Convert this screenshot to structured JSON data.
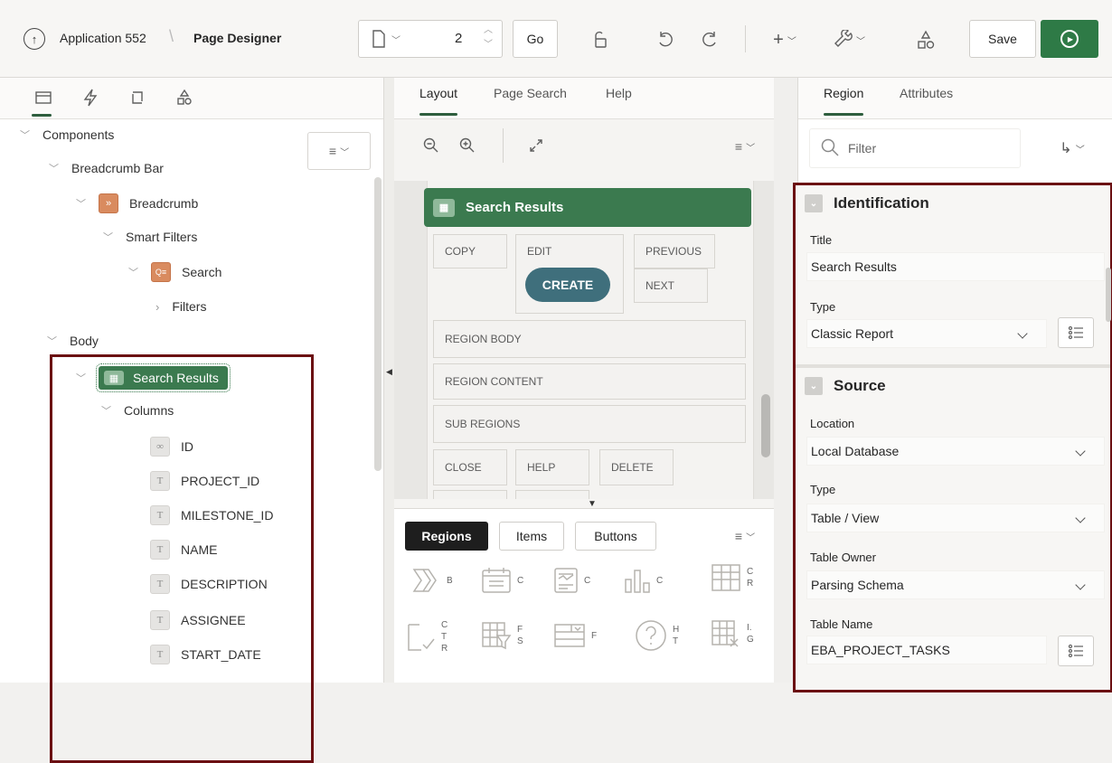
{
  "header": {
    "app_label": "Application 552",
    "page_designer": "Page Designer",
    "page_number": "2",
    "go": "Go",
    "save": "Save"
  },
  "left": {
    "tree": [
      {
        "label": "Components"
      },
      {
        "label": "Breadcrumb Bar"
      },
      {
        "label": "Breadcrumb"
      },
      {
        "label": "Smart Filters"
      },
      {
        "label": "Search"
      },
      {
        "label": "Filters"
      },
      {
        "label": "Body"
      },
      {
        "label": "Search Results"
      },
      {
        "label": "Columns"
      },
      {
        "label": "ID"
      },
      {
        "label": "PROJECT_ID"
      },
      {
        "label": "MILESTONE_ID"
      },
      {
        "label": "NAME"
      },
      {
        "label": "DESCRIPTION"
      },
      {
        "label": "ASSIGNEE"
      },
      {
        "label": "START_DATE"
      }
    ]
  },
  "middle": {
    "tabs": [
      "Layout",
      "Page Search",
      "Help"
    ],
    "region_title": "Search Results",
    "cells": {
      "copy": "COPY",
      "edit": "EDIT",
      "create": "CREATE",
      "previous": "PREVIOUS",
      "next": "NEXT",
      "region_body": "REGION BODY",
      "region_content": "REGION CONTENT",
      "sub_regions": "SUB REGIONS",
      "close": "CLOSE",
      "help": "HELP",
      "delete": "DELETE"
    },
    "gallery_tabs": [
      "Regions",
      "Items",
      "Buttons"
    ],
    "gallery_labels": [
      "B",
      "C",
      "C",
      "C",
      "C\nR",
      "C\nT\nR",
      "F\nS",
      "F",
      "H\nT",
      "I.\nG"
    ]
  },
  "right": {
    "tabs": [
      "Region",
      "Attributes"
    ],
    "filter_placeholder": "Filter",
    "identification": {
      "heading": "Identification",
      "title_label": "Title",
      "title_value": "Search Results",
      "type_label": "Type",
      "type_value": "Classic Report"
    },
    "source": {
      "heading": "Source",
      "location_label": "Location",
      "location_value": "Local Database",
      "type_label": "Type",
      "type_value": "Table / View",
      "owner_label": "Table Owner",
      "owner_value": "Parsing Schema",
      "table_label": "Table Name",
      "table_value": "EBA_PROJECT_TASKS"
    }
  },
  "colors": {
    "green": "#3b7a4f",
    "highlight_red": "#6b0f12",
    "breadcrumb_orange": "#cf7a54",
    "create_btn": "#3f6f7c"
  }
}
